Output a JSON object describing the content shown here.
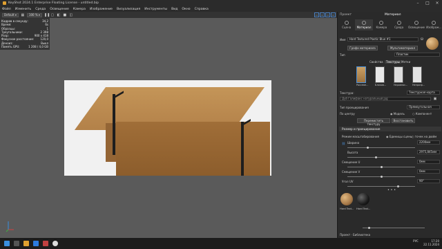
{
  "title": "KeyShot 2024.1 Enterprise Floating License - untitled.bip",
  "menu": [
    "Файл",
    "Изменить",
    "Среда",
    "Освещение",
    "Камера",
    "Изображение",
    "Визуализация",
    "Инструменты",
    "Вид",
    "Окно",
    "Справка"
  ],
  "toolbar": {
    "mode": "Default",
    "zoom": "100 %"
  },
  "stats": [
    {
      "k": "Кадров в секунду:",
      "v": "34,2"
    },
    {
      "k": "Время:",
      "v": "6s"
    },
    {
      "k": "Образцы:",
      "v": "1"
    },
    {
      "k": "Треугольники:",
      "v": "2 398"
    },
    {
      "k": "Разр:",
      "v": "900 x 418"
    },
    {
      "k": "Фокусное расстояние:",
      "v": "120,0"
    },
    {
      "k": "Деноиз:",
      "v": "Выкл"
    },
    {
      "k": "Память GPU:",
      "v": "1 208 / 4,0 GB"
    }
  ],
  "panel": {
    "project_label": "Проект",
    "material_header": "Материал",
    "tabs": [
      "Сцена",
      "Материал",
      "Камера",
      "Среда",
      "Освещение",
      "Изображ..."
    ],
    "name_label": "Имя",
    "name_value": "Hard Textured Plastic Blue #1",
    "graph_button": "Графа материала",
    "multi_button": "Мультиматериал",
    "type_label": "Тип",
    "type_value": "Пластик",
    "subtabs": [
      "Свойства",
      "Текстуры",
      "Метки"
    ],
    "thumb_labels": [
      "Рассеян...",
      "Бликов...",
      "Неровнос...",
      "Непрозр..."
    ],
    "texture_label": "Текстура:",
    "texture_type": "Текстурная карта",
    "texture_file": "Дуб Галифакс натуральный.jpg",
    "projection_label": "Тип проецирования",
    "projection_value": "Прямоугольная",
    "center_label": "По центру",
    "radio_model": "Модель",
    "radio_component": "Компонент",
    "move_button": "Перемистить текстуру",
    "restore_button": "Восстановить",
    "size_section": "Размер и проецирование",
    "scale_label": "Режим масштабирования",
    "radio_scene": "Единицы сцены",
    "radio_inch": "точек на дюйм",
    "width_label": "Ширина",
    "width_value": "2200мм",
    "height_label": "Высота",
    "height_value": "2975,845мм",
    "offset_u_label": "Смещение U",
    "offset_u_value": "0мм",
    "offset_v_label": "Смещение V",
    "offset_v_value": "0мм",
    "angle_label": "Угол UV",
    "angle_value": "90°",
    "ball1": "Hard Text...",
    "ball2": "Hard Text...",
    "bottom_tabs": "Проект · Библиотека"
  },
  "taskbar": {
    "lang": "РУС",
    "time": "17:20",
    "date": "22.11.2024"
  }
}
